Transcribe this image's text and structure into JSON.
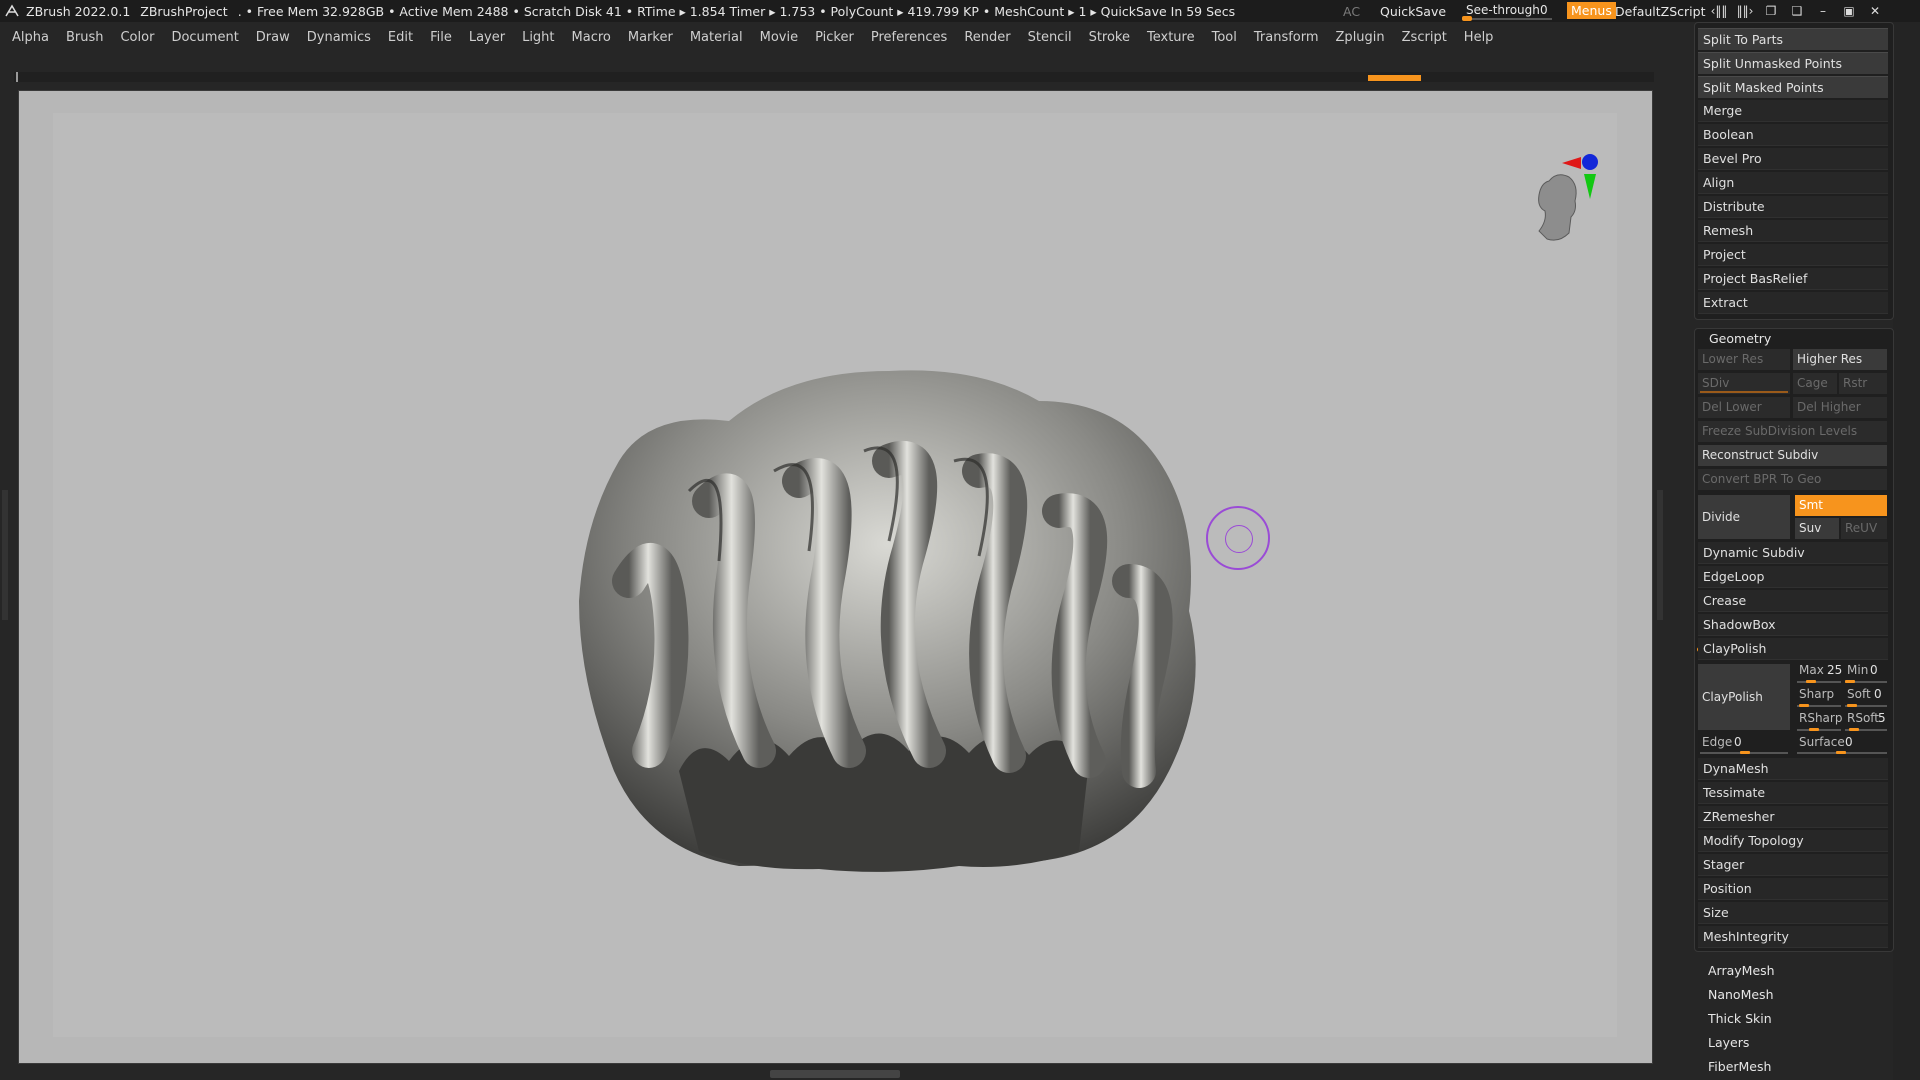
{
  "titlebar": {
    "app": "ZBrush 2022.0.1",
    "project": "ZBrushProject",
    "stats": ". • Free Mem 32.928GB • Active Mem 2488 • Scratch Disk 41 •  RTime ▸ 1.854 Timer ▸ 1.753 • PolyCount ▸ 419.799 KP  • MeshCount ▸ 1  ▸ QuickSave In 59 Secs",
    "ac": "AC",
    "quicksave": "QuickSave",
    "seethrough_label": "See-through",
    "seethrough_value": "0",
    "seethrough_level": 0,
    "menus": "Menus",
    "default_zscript": "DefaultZScript",
    "controls": [
      "‹‖‖",
      "‖‖›",
      "❐",
      "❑",
      "–",
      "▣",
      "✕"
    ]
  },
  "menu": [
    "Alpha",
    "Brush",
    "Color",
    "Document",
    "Draw",
    "Dynamics",
    "Edit",
    "File",
    "Layer",
    "Light",
    "Macro",
    "Marker",
    "Material",
    "Movie",
    "Picker",
    "Preferences",
    "Render",
    "Stencil",
    "Stroke",
    "Texture",
    "Tool",
    "Transform",
    "Zplugin",
    "Zscript",
    "Help"
  ],
  "subtool_actions": [
    "Split To Parts",
    "Split Unmasked Points",
    "Split Masked Points"
  ],
  "subtool_items": [
    "Merge",
    "Boolean",
    "Bevel Pro",
    "Align",
    "Distribute",
    "Remesh",
    "Project",
    "Project BasRelief",
    "Extract"
  ],
  "geometry": {
    "title": "Geometry",
    "lower_res": "Lower Res",
    "higher_res": "Higher Res",
    "sdiv": "SDiv",
    "cage": "Cage",
    "rstr": "Rstr",
    "del_lower": "Del Lower",
    "del_higher": "Del Higher",
    "freeze": "Freeze SubDivision Levels",
    "reconstruct": "Reconstruct Subdiv",
    "convert_bpr": "Convert BPR To Geo",
    "divide": "Divide",
    "smt": "Smt",
    "suv": "Suv",
    "reuv": "ReUV",
    "items_a": [
      "Dynamic Subdiv",
      "EdgeLoop",
      "Crease",
      "ShadowBox"
    ],
    "claypolish": "ClayPolish",
    "claypolish_btn": "ClayPolish",
    "max": "Max",
    "max_val": "25",
    "min": "Min",
    "min_val": "0",
    "sharp": "Sharp",
    "soft": "Soft",
    "soft_val": "0",
    "rsharp": "RSharp",
    "rsoft": "RSoft",
    "rsoft_val": "5",
    "edge": "Edge",
    "edge_val": "0",
    "surface": "Surface",
    "surface_val": "0",
    "items_b": [
      "DynaMesh",
      "Tessimate",
      "ZRemesher",
      "Modify Topology",
      "Stager",
      "Position",
      "Size",
      "MeshIntegrity"
    ]
  },
  "sub_palettes": [
    "ArrayMesh",
    "NanoMesh",
    "Thick Skin",
    "Layers",
    "FiberMesh"
  ],
  "colors": {
    "accent": "#f7941d",
    "cursor": "#9a4bd6",
    "viewport": "#b7b7b7"
  }
}
